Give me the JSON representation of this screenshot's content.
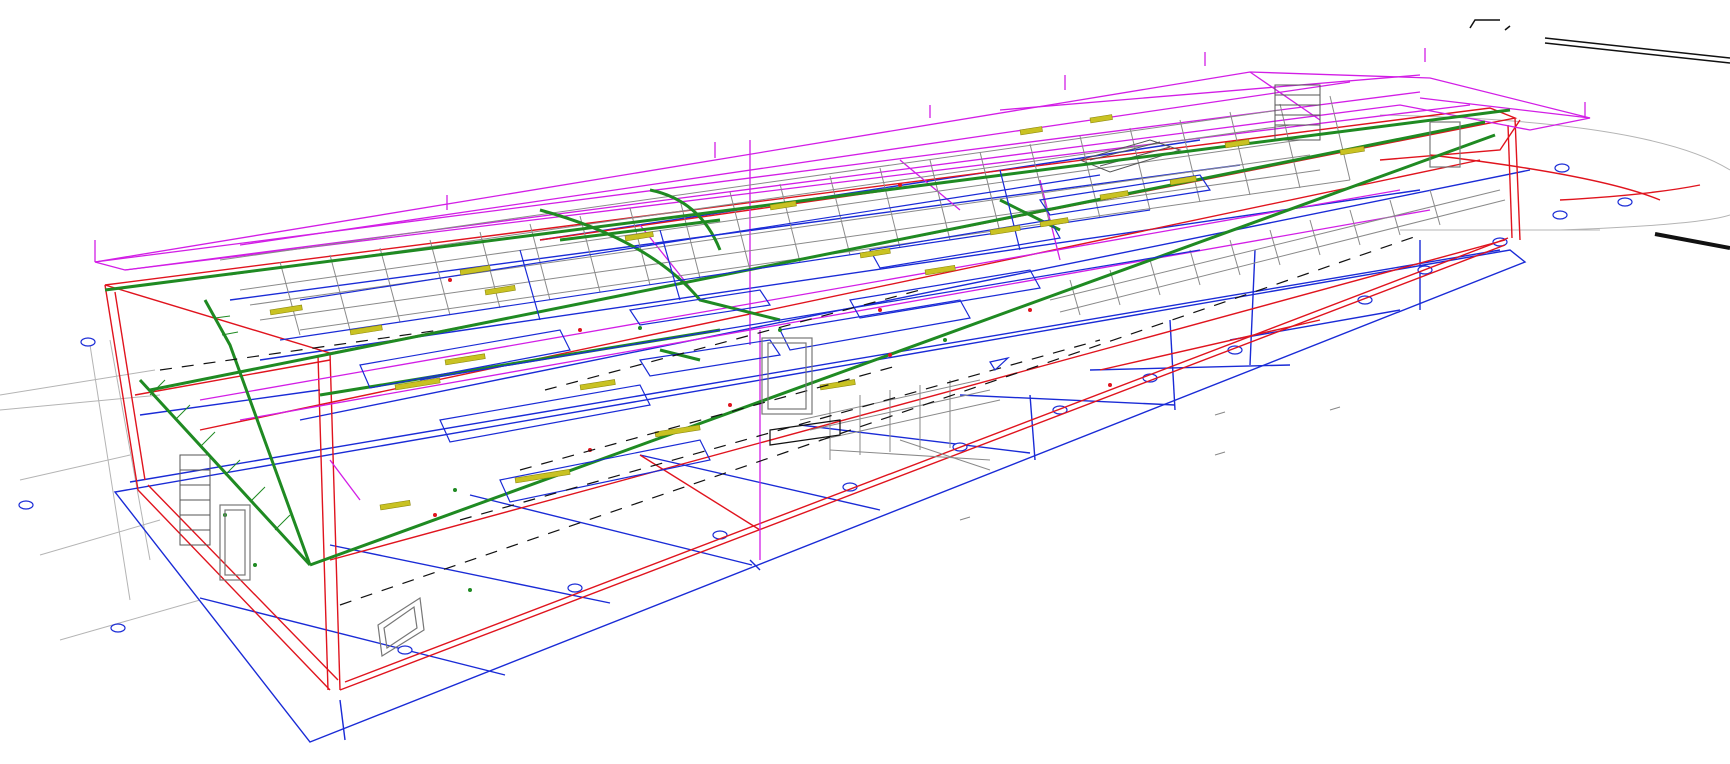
{
  "view": {
    "background": "#ffffff"
  },
  "layers": {
    "architecture_red": "#e0141e",
    "grid_blue": "#1a2bd6",
    "roof_magenta": "#d21ee6",
    "cable_tray_green": "#1f8a22",
    "ceiling_grid_gray": "#8a8a8a",
    "light_fixture_yellow": "#c9c222",
    "site_gray": "#b4b4b4",
    "black": "#111111"
  },
  "icons": {
    "grid_bubble": "grid-bubble-icon",
    "section_marker": "section-marker-icon"
  }
}
